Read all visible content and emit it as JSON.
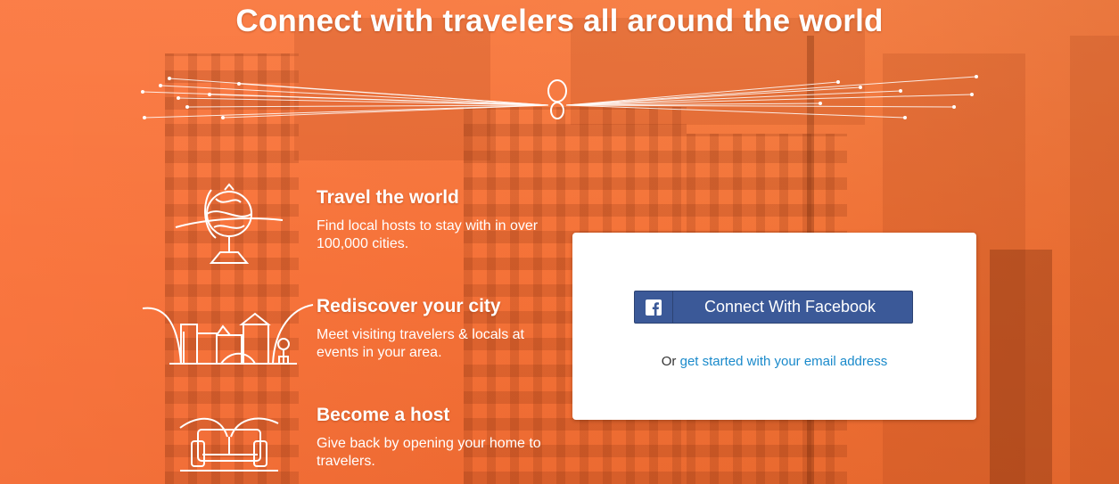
{
  "hero": {
    "headline": "Connect with travelers all around the world"
  },
  "features": [
    {
      "title": "Travel the world",
      "description": "Find local hosts to stay with in over 100,000 cities.",
      "icon": "globe-icon"
    },
    {
      "title": "Rediscover your city",
      "description": "Meet visiting travelers & locals at events in your area.",
      "icon": "city-icon"
    },
    {
      "title": "Become a host",
      "description": "Give back by opening your home to travelers.",
      "icon": "couch-icon"
    }
  ],
  "signup": {
    "facebook_label": "Connect With Facebook",
    "alt_prefix": "Or",
    "email_link": "get started with your email address"
  },
  "colors": {
    "background": "#f47a3a",
    "facebook": "#3b5998",
    "link": "#1a8acb"
  },
  "decor": {
    "logo": "infinity-loop-icon"
  }
}
